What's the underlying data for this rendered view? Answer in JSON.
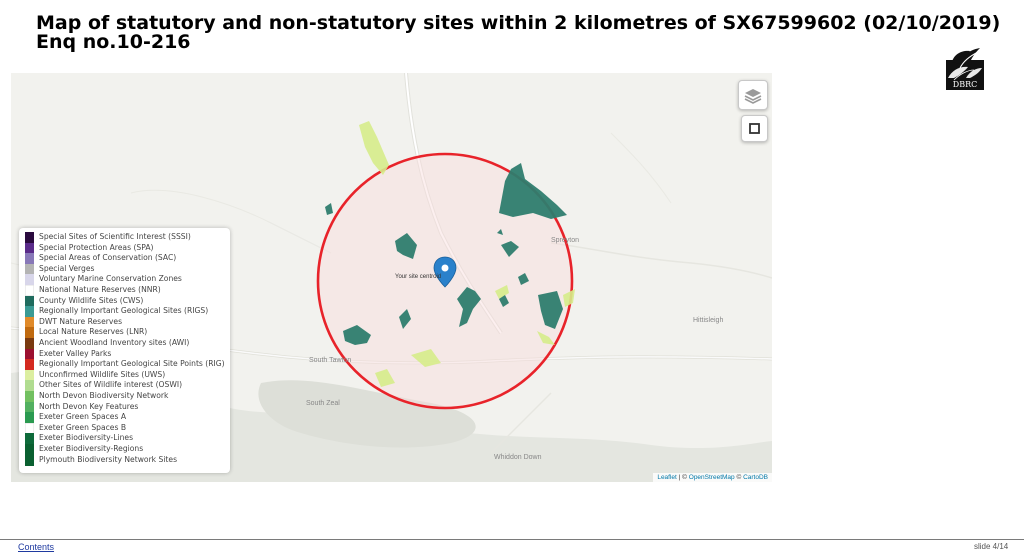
{
  "title": {
    "line1": "Map of statutory and non-statutory sites within 2 kilometres of SX67599602 (02/10/2019)",
    "line2": "Enq no.10-216"
  },
  "logo": {
    "text": "DBRC"
  },
  "map": {
    "marker_label": "Your site centroid",
    "places": {
      "spreyton": "Spreyton",
      "hittisleigh": "Hittisleigh",
      "south_tawton": "South Tawton",
      "south_zeal": "South Zeal",
      "whiddon_down": "Whiddon Down"
    },
    "attribution": {
      "leaflet": "Leaflet",
      "sep1": " | © ",
      "osm": "OpenStreetMap",
      "sep2": " © ",
      "carto": "CartoDB"
    },
    "circle_color": "#e8232a",
    "site_color": "#2e7d6e",
    "uws_color": "#d6ec8a"
  },
  "legend": [
    {
      "label": "Special Sites of Scientific Interest (SSSI)",
      "color": "#2a0a3e"
    },
    {
      "label": "Special Protection Areas (SPA)",
      "color": "#5a2b8a"
    },
    {
      "label": "Special Areas of Conservation (SAC)",
      "color": "#8878b8"
    },
    {
      "label": "Special Verges",
      "color": "#b4b4b4"
    },
    {
      "label": "Voluntary Marine Conservation Zones",
      "color": "#d8d6ea"
    },
    {
      "label": "National Nature Reserves (NNR)",
      "color": "#ffffff"
    },
    {
      "label": "County Wildlife Sites (CWS)",
      "color": "#1f6b5e"
    },
    {
      "label": "Regionally Important Geological Sites (RIGS)",
      "color": "#3a9a94"
    },
    {
      "label": "DWT Nature Reserves",
      "color": "#e08a2a"
    },
    {
      "label": "Local Nature Reserves (LNR)",
      "color": "#c06a10"
    },
    {
      "label": "Ancient Woodland Inventory sites (AWI)",
      "color": "#7a3a10"
    },
    {
      "label": "Exeter Valley Parks",
      "color": "#9c1030"
    },
    {
      "label": "Regionally Important Geological Site Points (RIG)",
      "color": "#d42a20"
    },
    {
      "label": "Unconfirmed Wildlife Sites (UWS)",
      "color": "#dceea0"
    },
    {
      "label": "Other Sites of Wildlife interest (OSWI)",
      "color": "#b0dc90"
    },
    {
      "label": "North Devon Biodiversity Network",
      "color": "#72c060"
    },
    {
      "label": "North Devon Key Features",
      "color": "#52b060"
    },
    {
      "label": "Exeter Green Spaces A",
      "color": "#2a9a50"
    },
    {
      "label": "Exeter Green Spaces B",
      "color": "#ffffff"
    },
    {
      "label": "Exeter Biodiversity-Lines",
      "color": "#0e6a3a"
    },
    {
      "label": "Exeter Biodiversity-Regions",
      "color": "#0a6030"
    },
    {
      "label": "Plymouth Biodiversity Network Sites",
      "color": "#0a6030"
    }
  ],
  "footer": {
    "contents": "Contents",
    "slide": "slide 4/14"
  }
}
